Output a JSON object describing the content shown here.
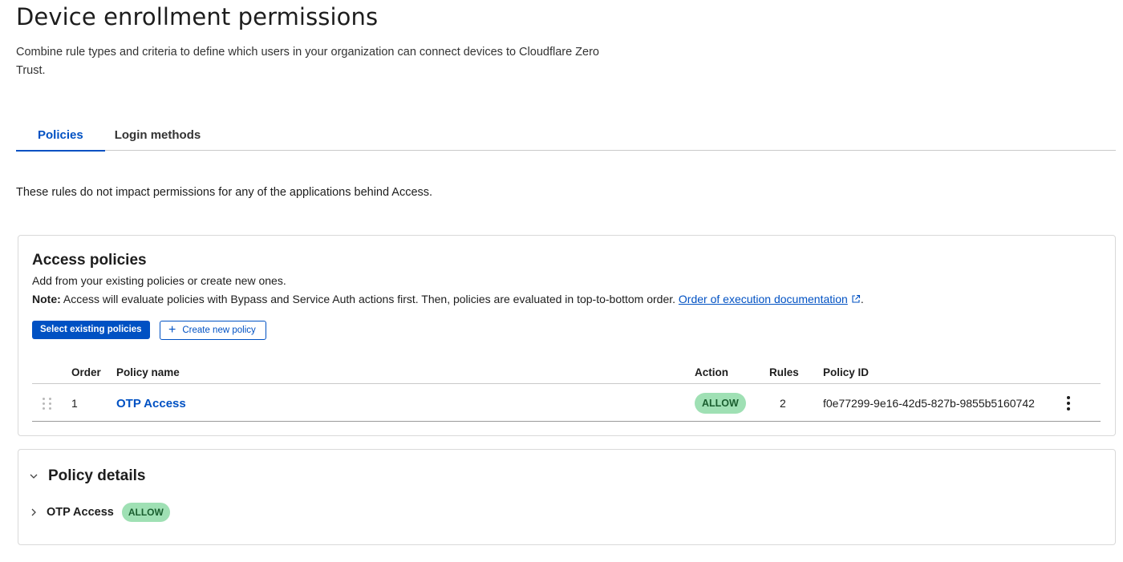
{
  "page": {
    "title": "Device enrollment permissions",
    "description": "Combine rule types and criteria to define which users in your organization can connect devices to Cloudflare Zero Trust."
  },
  "tabs": [
    {
      "label": "Policies",
      "active": true
    },
    {
      "label": "Login methods",
      "active": false
    }
  ],
  "info_text": "These rules do not impact permissions for any of the applications behind Access.",
  "access_policies": {
    "title": "Access policies",
    "subtitle": "Add from your existing policies or create new ones.",
    "note_label": "Note:",
    "note_text": " Access will evaluate policies with Bypass and Service Auth actions first. Then, policies are evaluated in top-to-bottom order. ",
    "doc_link": "Order of execution documentation",
    "note_end": ".",
    "select_button": "Select existing policies",
    "create_button": "Create new policy",
    "columns": {
      "order": "Order",
      "policy_name": "Policy name",
      "action": "Action",
      "rules": "Rules",
      "policy_id": "Policy ID"
    },
    "rows": [
      {
        "order": "1",
        "policy_name": "OTP Access",
        "action": "ALLOW",
        "rules": "2",
        "policy_id": "f0e77299-9e16-42d5-827b-9855b5160742"
      }
    ]
  },
  "policy_details": {
    "title": "Policy details",
    "items": [
      {
        "label": "OTP Access",
        "action": "ALLOW"
      }
    ]
  },
  "colors": {
    "accent": "#0051c3",
    "allow_badge_bg": "#9fe0b4",
    "allow_badge_text": "#1a5e2f"
  }
}
